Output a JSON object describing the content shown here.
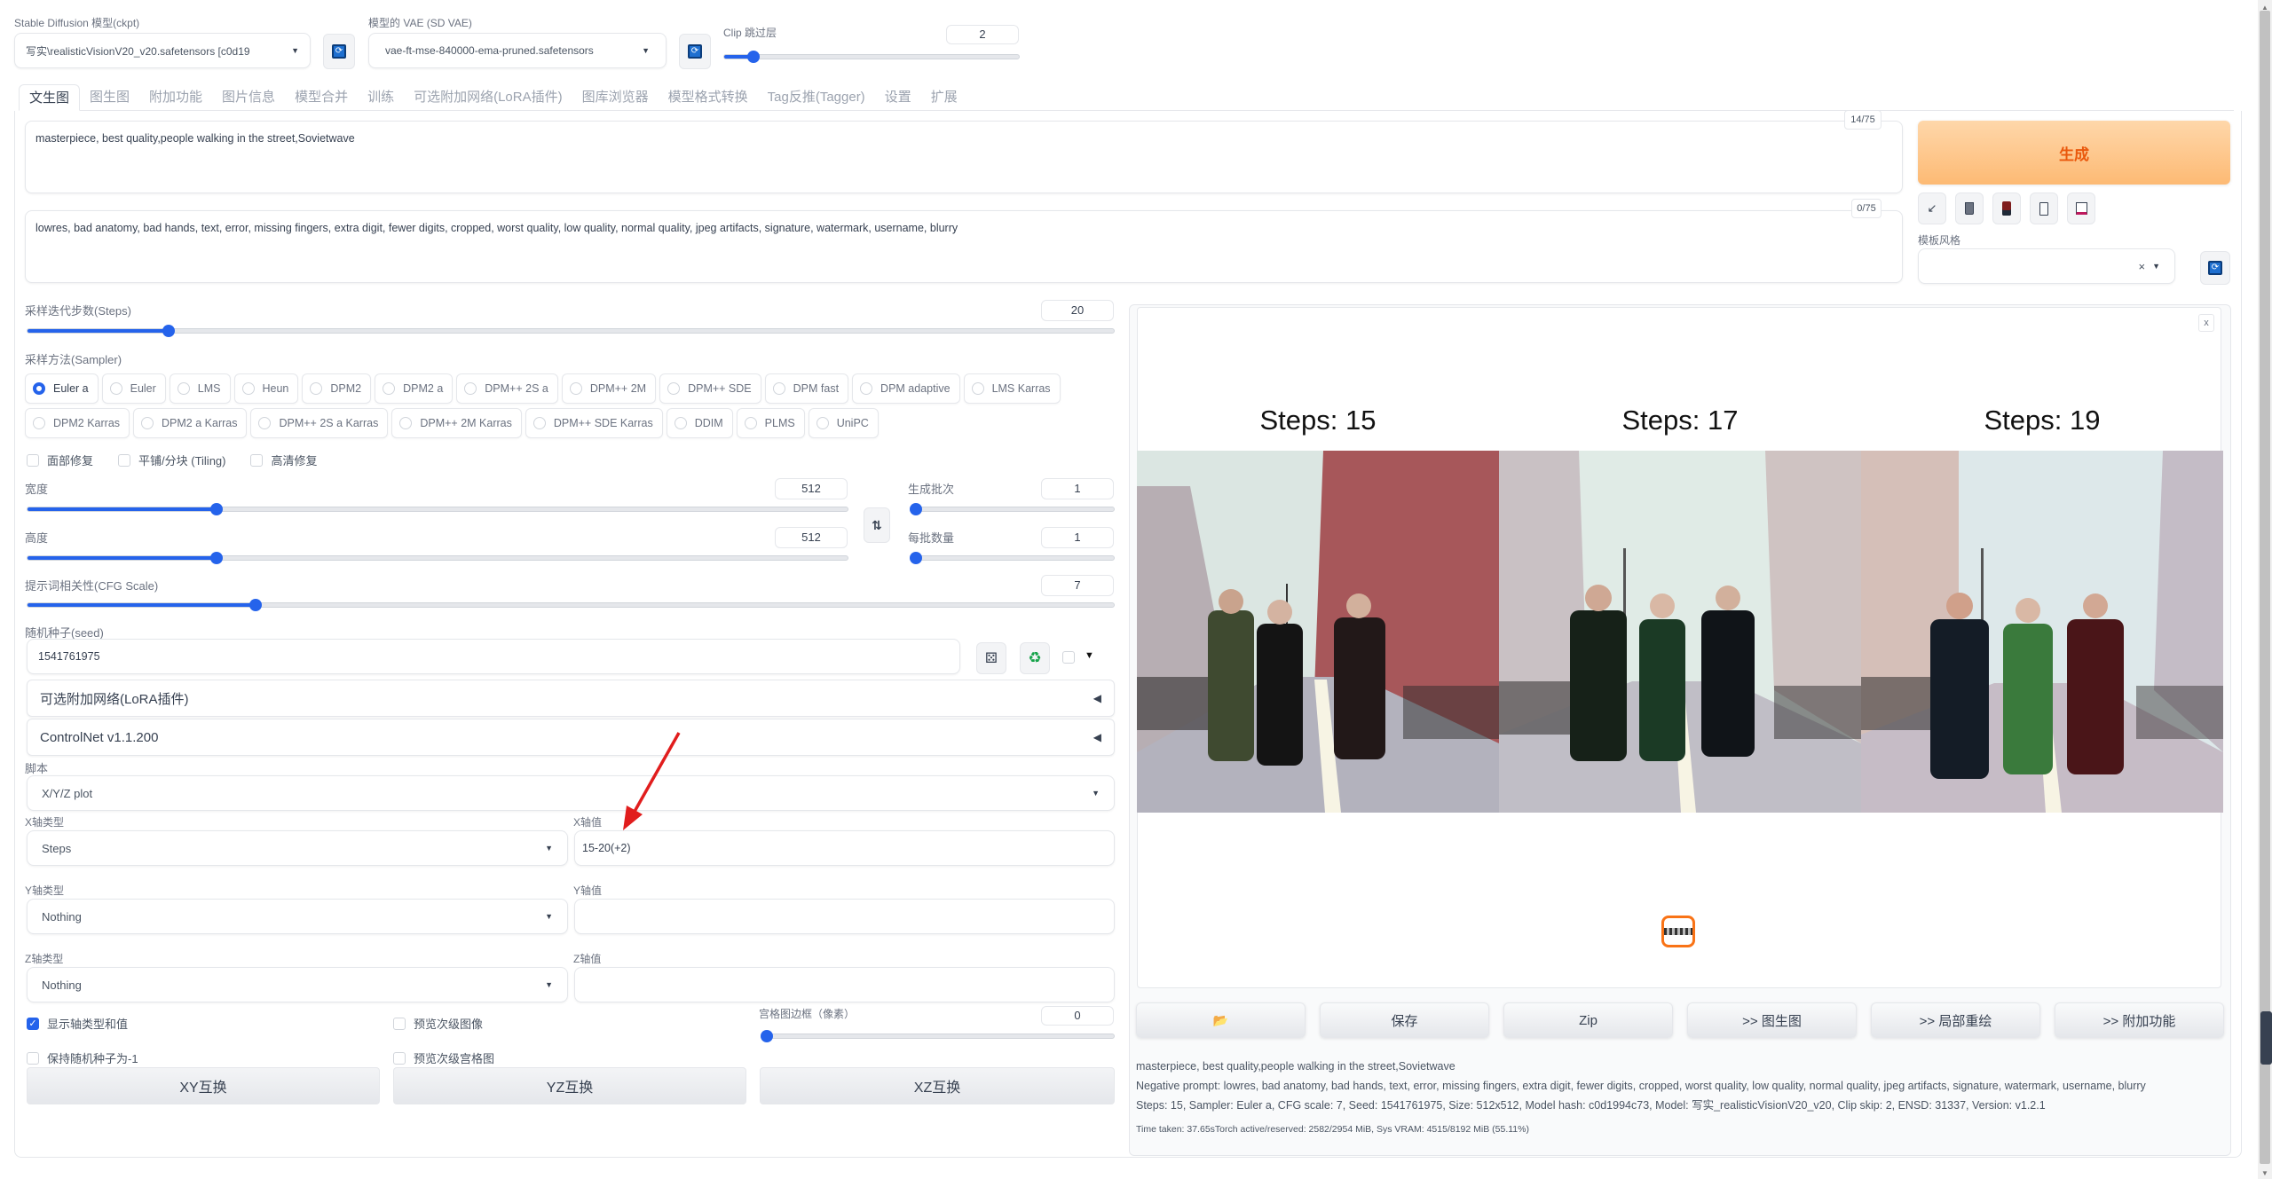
{
  "top": {
    "model_label": "Stable Diffusion 模型(ckpt)",
    "model_value": "写实\\realisticVisionV20_v20.safetensors [c0d19",
    "vae_label": "模型的 VAE (SD VAE)",
    "vae_value": "vae-ft-mse-840000-ema-pruned.safetensors",
    "clip_label": "Clip 跳过层",
    "clip_value": "2",
    "clip_fraction": 0.1
  },
  "tabs": [
    {
      "label": "文生图",
      "active": true
    },
    {
      "label": "图生图"
    },
    {
      "label": "附加功能"
    },
    {
      "label": "图片信息"
    },
    {
      "label": "模型合并"
    },
    {
      "label": "训练"
    },
    {
      "label": "可选附加网络(LoRA插件)"
    },
    {
      "label": "图库浏览器"
    },
    {
      "label": "模型格式转换"
    },
    {
      "label": "Tag反推(Tagger)"
    },
    {
      "label": "设置"
    },
    {
      "label": "扩展"
    }
  ],
  "prompt": {
    "positive": "masterpiece, best quality,people walking in the street,Sovietwave",
    "positive_count": "14/75",
    "negative": "lowres, bad anatomy, bad hands, text, error, missing fingers, extra digit, fewer digits, cropped, worst quality, low quality, normal quality, jpeg artifacts, signature, watermark, username, blurry",
    "negative_count": "0/75"
  },
  "generate": {
    "label": "生成",
    "style_label": "模板风格",
    "style_clear": "×"
  },
  "steps": {
    "label": "采样迭代步数(Steps)",
    "value": "20",
    "fraction": 0.13
  },
  "sampler": {
    "label": "采样方法(Sampler)",
    "options": [
      "Euler a",
      "Euler",
      "LMS",
      "Heun",
      "DPM2",
      "DPM2 a",
      "DPM++ 2S a",
      "DPM++ 2M",
      "DPM++ SDE",
      "DPM fast",
      "DPM adaptive",
      "LMS Karras",
      "DPM2 Karras",
      "DPM2 a Karras",
      "DPM++ 2S a Karras",
      "DPM++ 2M Karras",
      "DPM++ SDE Karras",
      "DDIM",
      "PLMS",
      "UniPC"
    ],
    "selected": "Euler a"
  },
  "options": {
    "face_restore": "面部修复",
    "tiling": "平铺/分块 (Tiling)",
    "hires": "高清修复"
  },
  "width": {
    "label": "宽度",
    "value": "512",
    "fraction": 0.23
  },
  "height": {
    "label": "高度",
    "value": "512",
    "fraction": 0.23
  },
  "batch_count": {
    "label": "生成批次",
    "value": "1",
    "fraction": 0.0
  },
  "batch_size": {
    "label": "每批数量",
    "value": "1",
    "fraction": 0.0
  },
  "swap_icon": "⇅",
  "cfg": {
    "label": "提示词相关性(CFG Scale)",
    "value": "7",
    "fraction": 0.21
  },
  "seed": {
    "label": "随机种子(seed)",
    "value": "1541761975"
  },
  "accordions": {
    "lora": "可选附加网络(LoRA插件)",
    "controlnet": "ControlNet v1.1.200"
  },
  "script": {
    "label": "脚本",
    "value": "X/Y/Z plot",
    "x_type_label": "X轴类型",
    "x_type": "Steps",
    "x_values_label": "X轴值",
    "x_values": "15-20(+2)",
    "y_type_label": "Y轴类型",
    "y_type": "Nothing",
    "y_values_label": "Y轴值",
    "y_values": "",
    "z_type_label": "Z轴类型",
    "z_type": "Nothing",
    "z_values_label": "Z轴值",
    "z_values": "",
    "show_axis": "显示轴类型和值",
    "show_axis_checked": true,
    "keep_seed": "保持随机种子为-1",
    "preview_sub": "预览次级图像",
    "preview_grid": "预览次级宫格图",
    "margin_label": "宫格图边框（像素）",
    "margin_value": "0",
    "margin_fraction": 0.0,
    "swap_xy": "XY互换",
    "swap_yz": "YZ互换",
    "swap_xz": "XZ互换"
  },
  "output": {
    "close": "x",
    "grid_labels": [
      "Steps: 15",
      "Steps: 17",
      "Steps: 19"
    ],
    "buttons": {
      "folder": "📂",
      "save": "保存",
      "zip": "Zip",
      "img2img": ">> 图生图",
      "inpaint": ">> 局部重绘",
      "extras": ">> 附加功能"
    },
    "info_prompt": "masterpiece, best quality,people walking in the street,Sovietwave",
    "info_negative": "Negative prompt: lowres, bad anatomy, bad hands, text, error, missing fingers, extra digit, fewer digits, cropped, worst quality, low quality, normal quality, jpeg artifacts, signature, watermark, username, blurry",
    "info_params": "Steps: 15, Sampler: Euler a, CFG scale: 7, Seed: 1541761975, Size: 512x512, Model hash: c0d1994c73, Model: 写实_realisticVisionV20_v20, Clip skip: 2, ENSD: 31337, Version: v1.2.1",
    "time_taken": "Time taken: 37.65sTorch active/reserved: 2582/2954 MiB, Sys VRAM: 4515/8192 MiB (55.11%)"
  },
  "colors": {
    "accent": "#2563eb",
    "generate_bg": "#fdba74",
    "generate_text": "#ea580c",
    "annotation_arrow": "#e11d1d"
  }
}
